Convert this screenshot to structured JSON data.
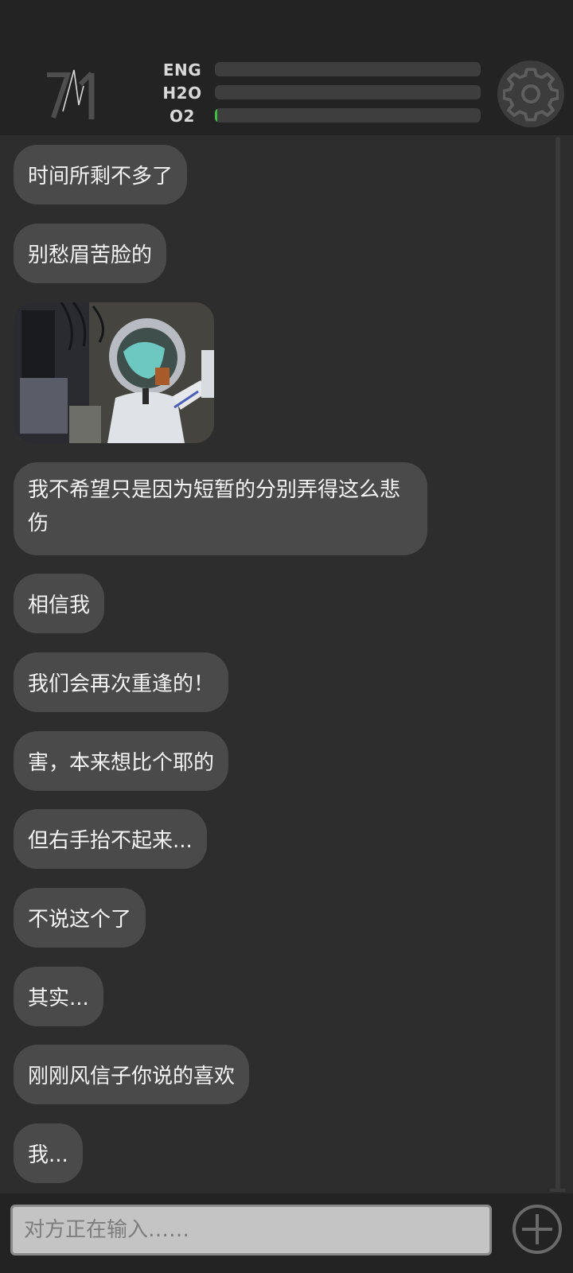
{
  "header": {
    "logo_icon": "71-signal-logo-icon",
    "meters": [
      {
        "label": "ENG",
        "level": 0.0
      },
      {
        "label": "H2O",
        "level": 0.0
      },
      {
        "label": "O2",
        "level": 0.01
      }
    ],
    "settings_icon": "gear-icon"
  },
  "chat": {
    "messages": [
      {
        "type": "text",
        "text": "时间所剩不多了"
      },
      {
        "type": "text",
        "text": "别愁眉苦脸的"
      },
      {
        "type": "image",
        "icon": "astronaut-girl-photo"
      },
      {
        "type": "text",
        "text": "我不希望只是因为短暂的分别弄得这么悲伤"
      },
      {
        "type": "text",
        "text": "相信我"
      },
      {
        "type": "text",
        "text": "我们会再次重逢的！"
      },
      {
        "type": "text",
        "text": "害，本来想比个耶的"
      },
      {
        "type": "text",
        "text": "但右手抬不起来..."
      },
      {
        "type": "text",
        "text": "不说这个了"
      },
      {
        "type": "text",
        "text": "其实..."
      },
      {
        "type": "text",
        "text": "刚刚风信子你说的喜欢"
      },
      {
        "type": "text",
        "text": "我..."
      }
    ]
  },
  "input": {
    "placeholder": "对方正在输入……",
    "add_icon": "plus-circle-icon"
  },
  "colors": {
    "background": "#2d2d2d",
    "header": "#232323",
    "bubble": "#4a4a4a",
    "meter_track": "#3e3e3e",
    "meter_fill": "#3fbf3f"
  }
}
